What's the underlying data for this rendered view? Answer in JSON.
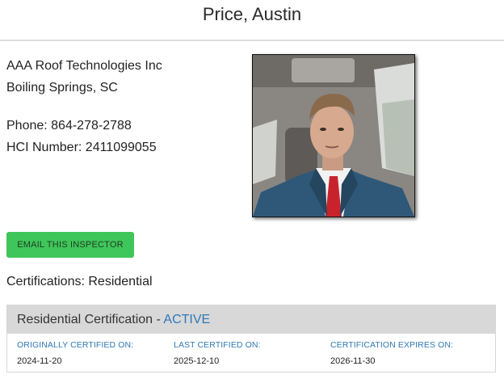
{
  "inspector": {
    "name": "Price, Austin",
    "company": "AAA Roof Technologies Inc",
    "location": "Boiling Springs, SC",
    "phone": "Phone: 864-278-2788",
    "hci_number": "HCI Number: 2411099055"
  },
  "actions": {
    "email_label": "EMAIL THIS INSPECTOR"
  },
  "certifications": {
    "summary": "Certifications: Residential",
    "panel": {
      "title": "Residential Certification - ",
      "status": "ACTIVE",
      "originally_label": "ORIGINALLY CERTIFIED ON:",
      "originally_value": "2024-11-20",
      "last_label": "LAST CERTIFIED ON:",
      "last_value": "2025-12-10",
      "expires_label": "CERTIFICATION EXPIRES ON:",
      "expires_value": "2026-11-30"
    }
  },
  "colors": {
    "button_green": "#3fc65a",
    "accent_blue": "#3079b5",
    "panel_header_gray": "#d8d8d8"
  }
}
